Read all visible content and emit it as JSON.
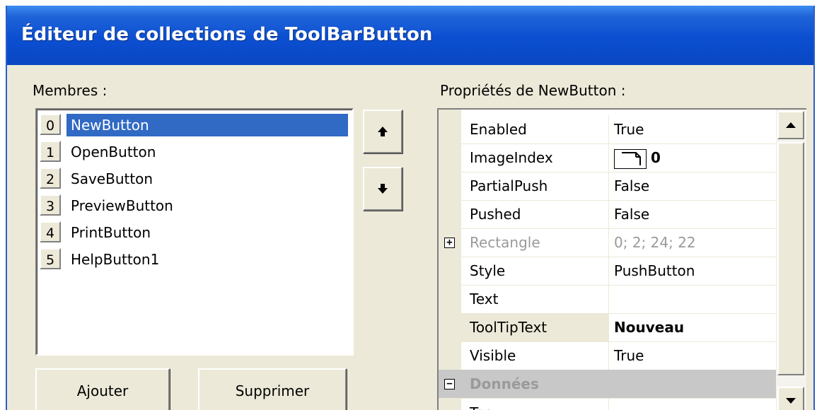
{
  "window": {
    "title": "Éditeur de collections de ToolBarButton"
  },
  "members": {
    "label": "Membres :",
    "items": [
      {
        "index": "0",
        "name": "NewButton",
        "selected": true
      },
      {
        "index": "1",
        "name": "OpenButton"
      },
      {
        "index": "2",
        "name": "SaveButton"
      },
      {
        "index": "3",
        "name": "PreviewButton"
      },
      {
        "index": "4",
        "name": "PrintButton"
      },
      {
        "index": "5",
        "name": "HelpButton1"
      }
    ]
  },
  "buttons": {
    "add": "Ajouter",
    "remove": "Supprimer"
  },
  "properties": {
    "label": "Propriétés de NewButton :",
    "rows": [
      {
        "name": "Enabled",
        "value": "True"
      },
      {
        "name": "ImageIndex",
        "value": "0"
      },
      {
        "name": "PartialPush",
        "value": "False"
      },
      {
        "name": "Pushed",
        "value": "False"
      },
      {
        "name": "Rectangle",
        "value": "0; 2; 24; 22"
      },
      {
        "name": "Style",
        "value": "PushButton"
      },
      {
        "name": "Text",
        "value": ""
      },
      {
        "name": "ToolTipText",
        "value": "Nouveau"
      },
      {
        "name": "Visible",
        "value": "True"
      },
      {
        "name": "Données",
        "value": ""
      },
      {
        "name": "Tag",
        "value": ""
      }
    ]
  },
  "colors": {
    "title_bar": "#0b4fd1",
    "selection": "#316ac5",
    "dialog_bg": "#ece9d8"
  }
}
